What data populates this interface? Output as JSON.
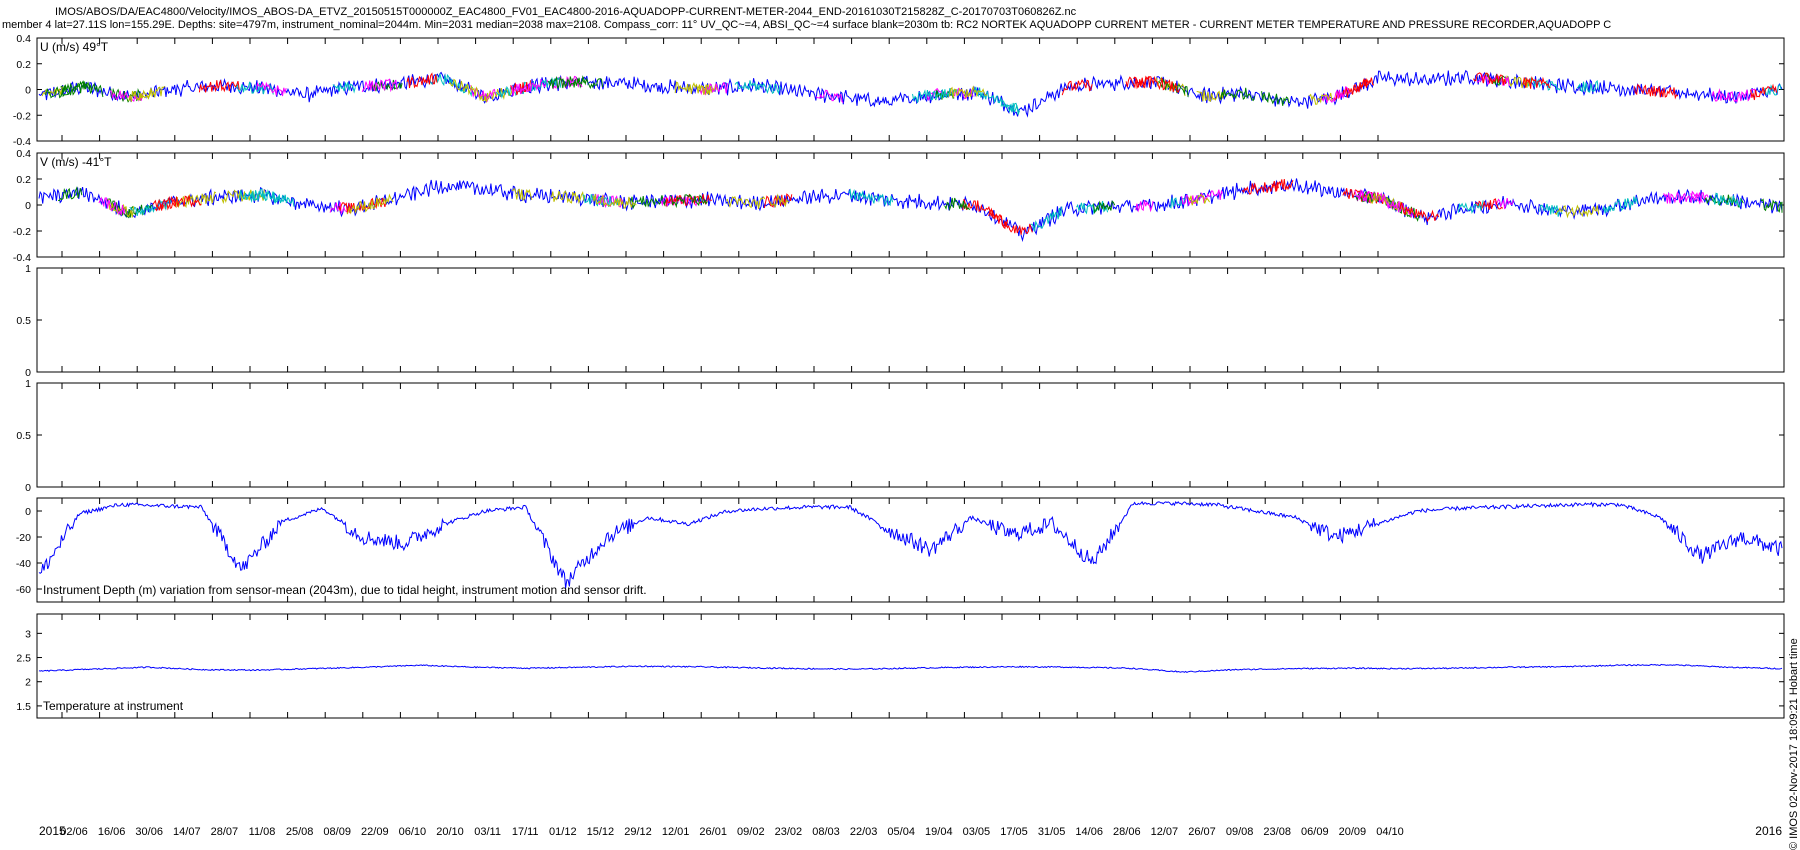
{
  "header": {
    "line1": "IMOS/ABOS/DA/EAC4800/Velocity/IMOS_ABOS-DA_ETVZ_20150515T000000Z_EAC4800_FV01_EAC4800-2016-AQUADOPP-CURRENT-METER-2044_END-20161030T215828Z_C-20170703T060826Z.nc",
    "line2": "member 4 lat=27.11S lon=155.29E. Depths: site=4797m, instrument_nominal=2044m. Min=2031 median=2038 max=2108. Compass_corr: 11° UV_QC~=4, ABSI_QC~=4 surface blank=2030m tb: RC2 NORTEK AQUADOPP CURRENT METER - CURRENT METER TEMPERATURE AND PRESSURE RECORDER,AQUADOPP C"
  },
  "credit": "© IMOS 02-Nov-2017 18:09:21 Hobart time",
  "colors": {
    "blue": "#0000ff",
    "green": "#008000",
    "magenta": "#ff00ff",
    "red": "#ff0000",
    "cyan": "#00bfbf",
    "yellow": "#bfbf00"
  },
  "chart_data": [
    {
      "type": "line",
      "title": "U (m/s) 49°T",
      "ylim": [
        -0.4,
        0.4
      ],
      "yticks": [
        "0.4",
        "0.2",
        "0",
        "-0.2",
        "-0.4"
      ],
      "series": [
        {
          "values": [
            -0.05,
            0.02,
            -0.06,
            0.0,
            0.03,
            0.01,
            -0.04,
            0.02,
            0.04,
            0.09,
            -0.06,
            0.03,
            0.06,
            0.05,
            0.02,
            0.0,
            0.03,
            -0.02,
            -0.06,
            -0.1,
            -0.04,
            -0.02,
            -0.17,
            0.02,
            0.05,
            0.06,
            -0.05,
            -0.03,
            -0.1,
            -0.06,
            0.09,
            0.07,
            0.1,
            0.06,
            0.03,
            0.02,
            -0.01,
            -0.03,
            -0.06,
            0.0
          ]
        }
      ]
    },
    {
      "type": "line",
      "title": "V (m/s) -41°T",
      "ylim": [
        -0.4,
        0.4
      ],
      "yticks": [
        "0.4",
        "0.2",
        "0",
        "-0.2",
        "-0.4"
      ],
      "series": [
        {
          "values": [
            0.05,
            0.1,
            -0.06,
            0.02,
            0.06,
            0.08,
            0.0,
            -0.03,
            0.05,
            0.15,
            0.12,
            0.07,
            0.06,
            0.02,
            0.03,
            0.04,
            0.01,
            0.05,
            0.08,
            0.04,
            0.02,
            0.0,
            -0.22,
            -0.03,
            -0.01,
            0.0,
            0.05,
            0.12,
            0.16,
            0.1,
            0.05,
            -0.1,
            -0.02,
            0.02,
            -0.05,
            -0.03,
            0.05,
            0.06,
            0.03,
            -0.02
          ]
        }
      ]
    },
    {
      "type": "line",
      "ylim": [
        0,
        1
      ],
      "yticks": [
        "1",
        "0.5",
        "0"
      ],
      "series": []
    },
    {
      "type": "line",
      "ylim": [
        0,
        1
      ],
      "yticks": [
        "1",
        "0.5",
        "0"
      ],
      "series": []
    },
    {
      "type": "line",
      "title": "Instrument Depth (m) variation from sensor-mean (2043m), due to tidal height, instrument motion and sensor drift.",
      "ylim": [
        -70,
        10
      ],
      "yticks": [
        "0",
        "-20",
        "-40",
        "-60"
      ],
      "series": [
        {
          "values": [
            -50,
            -2,
            5,
            4,
            3,
            -45,
            -8,
            2,
            -20,
            -25,
            -10,
            0,
            3,
            -55,
            -20,
            -5,
            -10,
            0,
            2,
            3,
            3,
            -15,
            -30,
            -5,
            -18,
            -10,
            -40,
            6,
            6,
            5,
            0,
            -5,
            -20,
            -10,
            0,
            2,
            3,
            4,
            5,
            5,
            -5,
            -35,
            -20,
            -30
          ]
        }
      ]
    },
    {
      "type": "line",
      "title": "Temperature at instrument",
      "ylim": [
        1.25,
        3.4
      ],
      "yticks": [
        "3",
        "2.5",
        "2",
        "1.5"
      ],
      "series": [
        {
          "values": [
            2.22,
            2.26,
            2.3,
            2.25,
            2.24,
            2.27,
            2.3,
            2.34,
            2.3,
            2.28,
            2.3,
            2.32,
            2.31,
            2.29,
            2.27,
            2.26,
            2.28,
            2.3,
            2.31,
            2.3,
            2.28,
            2.2,
            2.25,
            2.27,
            2.28,
            2.27,
            2.28,
            2.3,
            2.31,
            2.34,
            2.35,
            2.3,
            2.27
          ]
        }
      ]
    }
  ],
  "x_axis": {
    "labels": [
      "02/06",
      "16/06",
      "30/06",
      "14/07",
      "28/07",
      "11/08",
      "25/08",
      "08/09",
      "22/09",
      "06/10",
      "20/10",
      "03/11",
      "17/11",
      "01/12",
      "15/12",
      "29/12",
      "12/01",
      "26/01",
      "09/02",
      "23/02",
      "08/03",
      "22/03",
      "05/04",
      "19/04",
      "03/05",
      "17/05",
      "31/05",
      "14/06",
      "28/06",
      "12/07",
      "26/07",
      "09/08",
      "23/08",
      "06/09",
      "20/09",
      "04/10"
    ],
    "year_start": "2015",
    "year_end": "2016"
  }
}
